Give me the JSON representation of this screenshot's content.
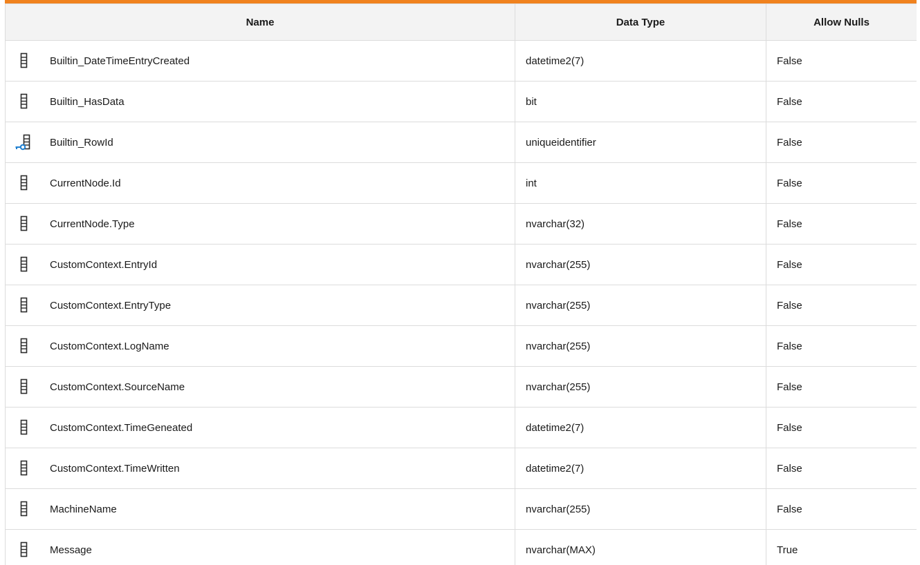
{
  "table": {
    "accent_color": "#f0821e",
    "headers": {
      "name": "Name",
      "data_type": "Data Type",
      "allow_nulls": "Allow Nulls"
    },
    "rows": [
      {
        "icon": "column-icon",
        "name": "Builtin_DateTimeEntryCreated",
        "data_type": "datetime2(7)",
        "allow_nulls": "False"
      },
      {
        "icon": "column-icon",
        "name": "Builtin_HasData",
        "data_type": "bit",
        "allow_nulls": "False"
      },
      {
        "icon": "primary-key-column-icon",
        "name": "Builtin_RowId",
        "data_type": "uniqueidentifier",
        "allow_nulls": "False"
      },
      {
        "icon": "column-icon",
        "name": "CurrentNode.Id",
        "data_type": "int",
        "allow_nulls": "False"
      },
      {
        "icon": "column-icon",
        "name": "CurrentNode.Type",
        "data_type": "nvarchar(32)",
        "allow_nulls": "False"
      },
      {
        "icon": "column-icon",
        "name": "CustomContext.EntryId",
        "data_type": "nvarchar(255)",
        "allow_nulls": "False"
      },
      {
        "icon": "column-icon",
        "name": "CustomContext.EntryType",
        "data_type": "nvarchar(255)",
        "allow_nulls": "False"
      },
      {
        "icon": "column-icon",
        "name": "CustomContext.LogName",
        "data_type": "nvarchar(255)",
        "allow_nulls": "False"
      },
      {
        "icon": "column-icon",
        "name": "CustomContext.SourceName",
        "data_type": "nvarchar(255)",
        "allow_nulls": "False"
      },
      {
        "icon": "column-icon",
        "name": "CustomContext.TimeGeneated",
        "data_type": "datetime2(7)",
        "allow_nulls": "False"
      },
      {
        "icon": "column-icon",
        "name": "CustomContext.TimeWritten",
        "data_type": "datetime2(7)",
        "allow_nulls": "False"
      },
      {
        "icon": "column-icon",
        "name": "MachineName",
        "data_type": "nvarchar(255)",
        "allow_nulls": "False"
      },
      {
        "icon": "column-icon",
        "name": "Message",
        "data_type": "nvarchar(MAX)",
        "allow_nulls": "True"
      }
    ]
  }
}
